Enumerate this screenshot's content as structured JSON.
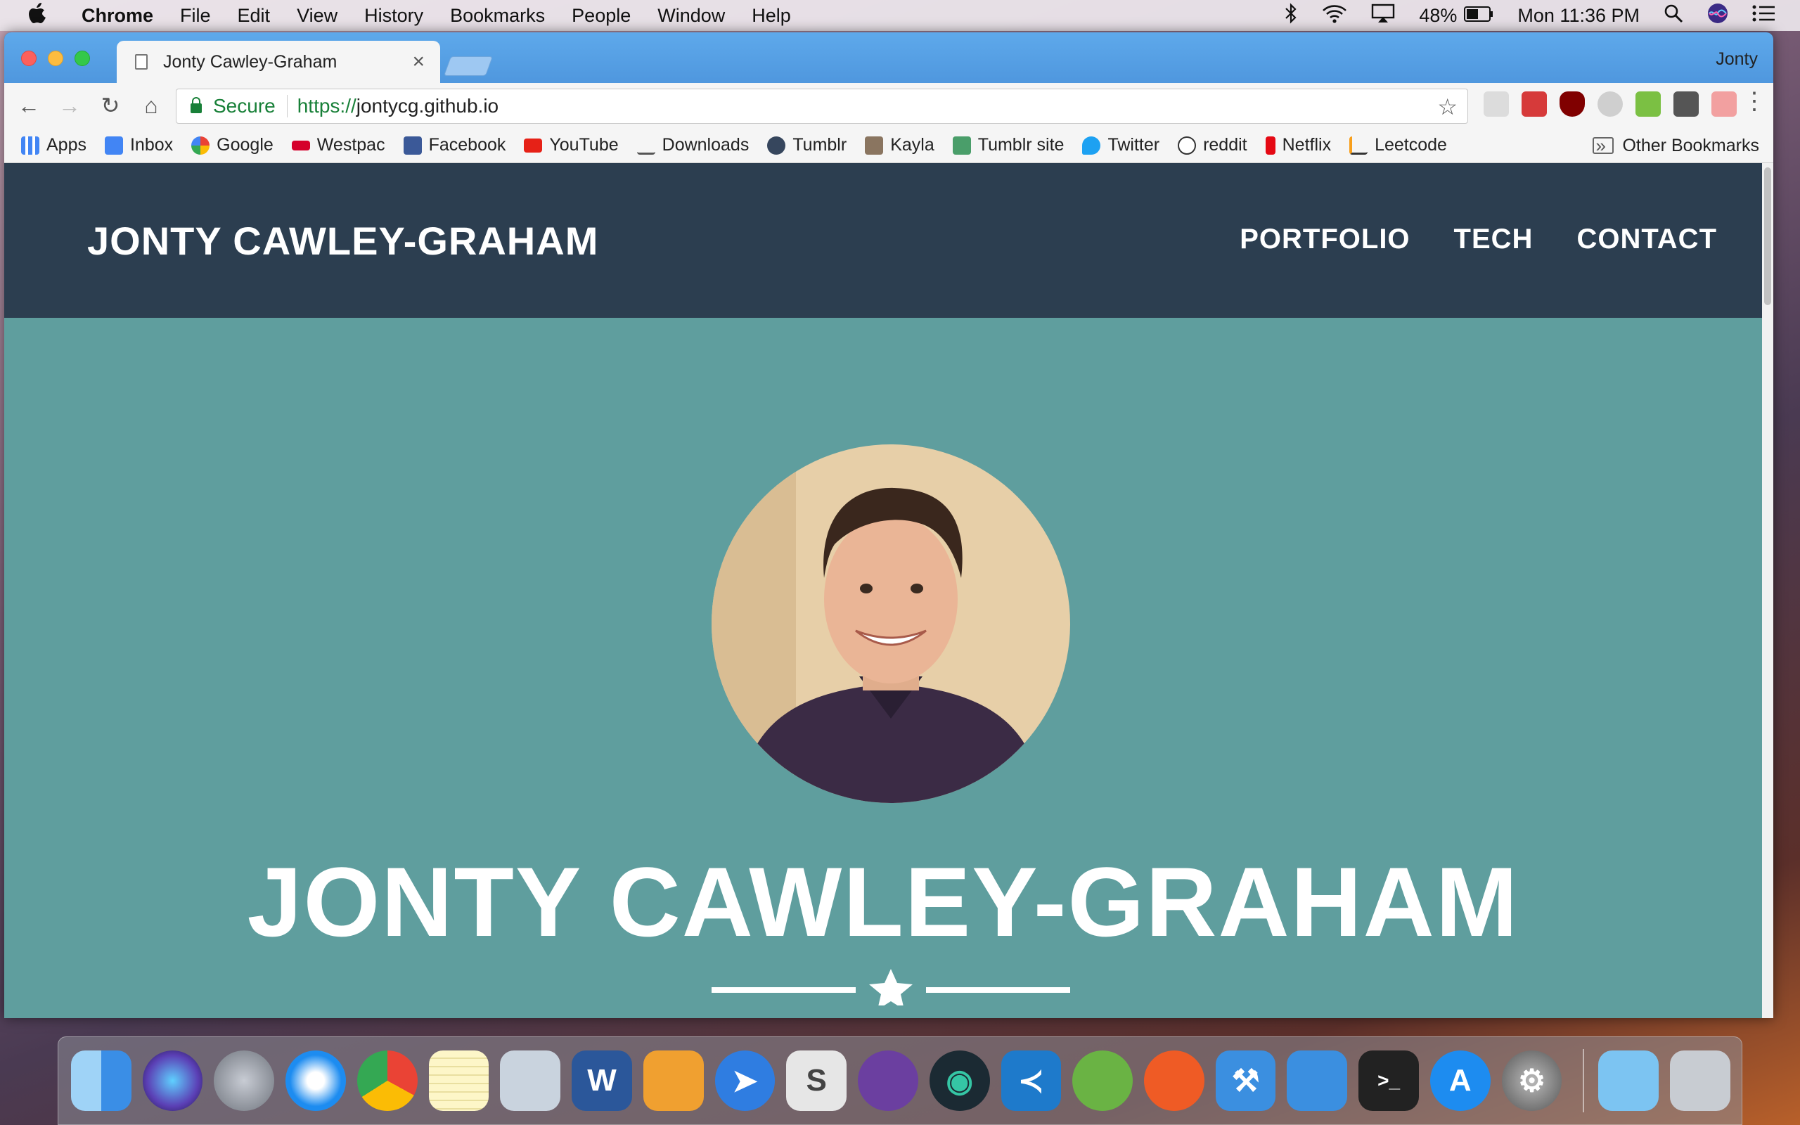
{
  "menubar": {
    "app": "Chrome",
    "items": [
      "File",
      "Edit",
      "View",
      "History",
      "Bookmarks",
      "People",
      "Window",
      "Help"
    ],
    "battery": "48%",
    "clock": "Mon 11:36 PM"
  },
  "browser": {
    "tab_title": "Jonty Cawley-Graham",
    "profile": "Jonty",
    "secure_label": "Secure",
    "url_scheme": "https://",
    "url_host": "jontycg.github.io"
  },
  "bookmarks": {
    "items": [
      {
        "label": "Apps",
        "icon": "apps-grid-icon",
        "color": "#4285f4"
      },
      {
        "label": "Inbox",
        "icon": "inbox-icon",
        "color": "#4285f4"
      },
      {
        "label": "Google",
        "icon": "google-icon",
        "color": "#ea4335"
      },
      {
        "label": "Westpac",
        "icon": "westpac-icon",
        "color": "#d5002b"
      },
      {
        "label": "Facebook",
        "icon": "facebook-icon",
        "color": "#3b5998"
      },
      {
        "label": "YouTube",
        "icon": "youtube-icon",
        "color": "#e62117"
      },
      {
        "label": "Downloads",
        "icon": "download-icon",
        "color": "#555555"
      },
      {
        "label": "Tumblr",
        "icon": "tumblr-icon",
        "color": "#36465d"
      },
      {
        "label": "Kayla",
        "icon": "photo-icon",
        "color": "#8a7560"
      },
      {
        "label": "Tumblr site",
        "icon": "site-icon",
        "color": "#4a9e6a"
      },
      {
        "label": "Twitter",
        "icon": "twitter-icon",
        "color": "#1da1f2"
      },
      {
        "label": "reddit",
        "icon": "reddit-icon",
        "color": "#ff4500"
      },
      {
        "label": "Netflix",
        "icon": "netflix-icon",
        "color": "#e50914"
      },
      {
        "label": "Leetcode",
        "icon": "leetcode-icon",
        "color": "#f89f1b"
      }
    ],
    "more": "»",
    "other": "Other Bookmarks"
  },
  "site": {
    "brand": "JONTY CAWLEY-GRAHAM",
    "nav": [
      "PORTFOLIO",
      "TECH",
      "CONTACT"
    ],
    "hero_title": "JONTY CAWLEY-GRAHAM",
    "colors": {
      "navbar": "#2c3e50",
      "hero": "#5f9e9e"
    }
  },
  "dock": {
    "apps": [
      {
        "name": "finder-icon",
        "color": "#3a8ee6"
      },
      {
        "name": "siri-icon",
        "color": "#5b3fb5"
      },
      {
        "name": "launchpad-icon",
        "color": "#8a8f99"
      },
      {
        "name": "safari-icon",
        "color": "#1d8cf0"
      },
      {
        "name": "chrome-icon",
        "color": "#34a853"
      },
      {
        "name": "notes-icon",
        "color": "#f6d55c"
      },
      {
        "name": "preview-icon",
        "color": "#c9d3de"
      },
      {
        "name": "word-icon",
        "color": "#2b579a"
      },
      {
        "name": "pages-icon",
        "color": "#f0a030"
      },
      {
        "name": "spark-icon",
        "color": "#2f7de1"
      },
      {
        "name": "slack-icon",
        "color": "#e6e6e6"
      },
      {
        "name": "pen-app-icon",
        "color": "#6b3fa0"
      },
      {
        "name": "gitkraken-icon",
        "color": "#1b2a33"
      },
      {
        "name": "vscode-icon",
        "color": "#1e7acb"
      },
      {
        "name": "android-studio-icon",
        "color": "#6ab344"
      },
      {
        "name": "postman-icon",
        "color": "#ef5b25"
      },
      {
        "name": "xcode-icon",
        "color": "#3b8fe0"
      },
      {
        "name": "simulator-icon",
        "color": "#3b8fe0"
      },
      {
        "name": "terminal-icon",
        "color": "#222222"
      },
      {
        "name": "app-store-icon",
        "color": "#1d8cf0"
      },
      {
        "name": "system-preferences-icon",
        "color": "#777777"
      },
      {
        "name": "folder-icon",
        "color": "#7cc4f2"
      },
      {
        "name": "trash-icon",
        "color": "#c8ccd2"
      }
    ]
  }
}
